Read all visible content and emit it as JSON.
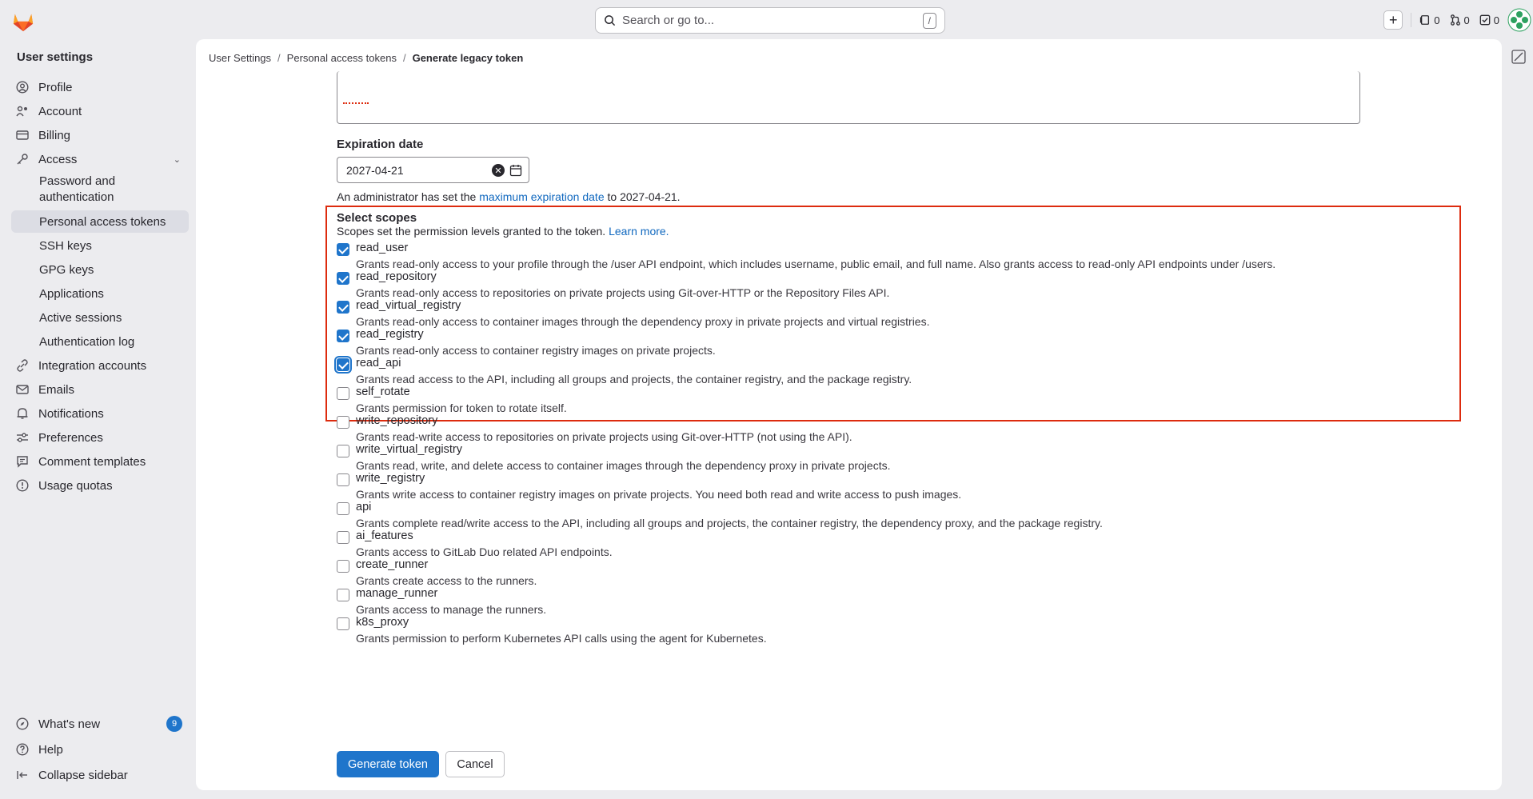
{
  "topbar": {
    "search_placeholder": "Search or go to...",
    "search_shortcut": "/",
    "issues_count": "0",
    "mr_count": "0",
    "todo_count": "0"
  },
  "sidebar": {
    "title": "User settings",
    "items": [
      {
        "label": "Profile",
        "icon": "profile-icon"
      },
      {
        "label": "Account",
        "icon": "account-icon"
      },
      {
        "label": "Billing",
        "icon": "billing-icon"
      },
      {
        "label": "Access",
        "icon": "key-icon"
      },
      {
        "label": "Password and authentication"
      },
      {
        "label": "Personal access tokens"
      },
      {
        "label": "SSH keys"
      },
      {
        "label": "GPG keys"
      },
      {
        "label": "Applications"
      },
      {
        "label": "Active sessions"
      },
      {
        "label": "Authentication log"
      },
      {
        "label": "Integration accounts",
        "icon": "link-icon"
      },
      {
        "label": "Emails",
        "icon": "mail-icon"
      },
      {
        "label": "Notifications",
        "icon": "bell-icon"
      },
      {
        "label": "Preferences",
        "icon": "preferences-icon"
      },
      {
        "label": "Comment templates",
        "icon": "comment-icon"
      },
      {
        "label": "Usage quotas",
        "icon": "quota-icon"
      }
    ],
    "whats_new": "What's new",
    "whats_new_count": "9",
    "help": "Help",
    "collapse": "Collapse sidebar"
  },
  "breadcrumb": {
    "items": [
      "User Settings",
      "Personal access tokens",
      "Generate legacy token"
    ]
  },
  "form": {
    "expiration_label": "Expiration date",
    "expiration_value": "2027-04-21",
    "admin_note_prefix": "An administrator has set the ",
    "admin_note_link": "maximum expiration date",
    "admin_note_suffix": " to 2027-04-21.",
    "scopes_label": "Select scopes",
    "scopes_help": "Scopes set the permission levels granted to the token. ",
    "scopes_help_link": "Learn more.",
    "scopes": [
      {
        "name": "read_user",
        "checked": true,
        "desc": "Grants read-only access to your profile through the /user API endpoint, which includes username, public email, and full name. Also grants access to read-only API endpoints under /users."
      },
      {
        "name": "read_repository",
        "checked": true,
        "desc": "Grants read-only access to repositories on private projects using Git-over-HTTP or the Repository Files API."
      },
      {
        "name": "read_virtual_registry",
        "checked": true,
        "desc": "Grants read-only access to container images through the dependency proxy in private projects and virtual registries."
      },
      {
        "name": "read_registry",
        "checked": true,
        "desc": "Grants read-only access to container registry images on private projects."
      },
      {
        "name": "read_api",
        "checked": true,
        "desc": "Grants read access to the API, including all groups and projects, the container registry, and the package registry."
      },
      {
        "name": "self_rotate",
        "checked": false,
        "desc": "Grants permission for token to rotate itself."
      },
      {
        "name": "write_repository",
        "checked": false,
        "desc": "Grants read-write access to repositories on private projects using Git-over-HTTP (not using the API)."
      },
      {
        "name": "write_virtual_registry",
        "checked": false,
        "desc": "Grants read, write, and delete access to container images through the dependency proxy in private projects."
      },
      {
        "name": "write_registry",
        "checked": false,
        "desc": "Grants write access to container registry images on private projects. You need both read and write access to push images."
      },
      {
        "name": "api",
        "checked": false,
        "desc": "Grants complete read/write access to the API, including all groups and projects, the container registry, the dependency proxy, and the package registry."
      },
      {
        "name": "ai_features",
        "checked": false,
        "desc": "Grants access to GitLab Duo related API endpoints."
      },
      {
        "name": "create_runner",
        "checked": false,
        "desc": "Grants create access to the runners."
      },
      {
        "name": "manage_runner",
        "checked": false,
        "desc": "Grants access to manage the runners."
      },
      {
        "name": "k8s_proxy",
        "checked": false,
        "desc": "Grants permission to perform Kubernetes API calls using the agent for Kubernetes."
      }
    ],
    "generate_button": "Generate token",
    "cancel_button": "Cancel"
  },
  "colors": {
    "accent": "#1f75cb",
    "highlight": "#dd2b0e"
  }
}
